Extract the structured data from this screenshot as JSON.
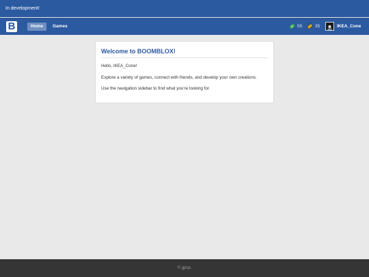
{
  "dev_banner": {
    "text": "In development!"
  },
  "navbar": {
    "logo_letter": "B",
    "links": [
      {
        "label": "Home",
        "active": true
      },
      {
        "label": "Games",
        "active": false
      }
    ],
    "currencies": [
      {
        "icon": "cash-icon",
        "amount": "55",
        "color": "#3fae49"
      },
      {
        "icon": "ticket-icon",
        "amount": "35",
        "color": "#e0b21e"
      }
    ],
    "user": {
      "name": "IKEA_Cone",
      "avatar_icon": "avatar-icon"
    }
  },
  "welcome": {
    "title": "Welcome to BOOMBLOX!",
    "greeting": "Hello, IKEA_Cone!",
    "line2": "Explore a variety of games, connect with friends, and develop your own creations.",
    "line3": "Use the navigation sidebar to find what you're looking for."
  },
  "footer": {
    "text": "© gpsp."
  },
  "colors": {
    "brand": "#2c5aa0",
    "background": "#e9e9e9",
    "footer": "#353535"
  }
}
